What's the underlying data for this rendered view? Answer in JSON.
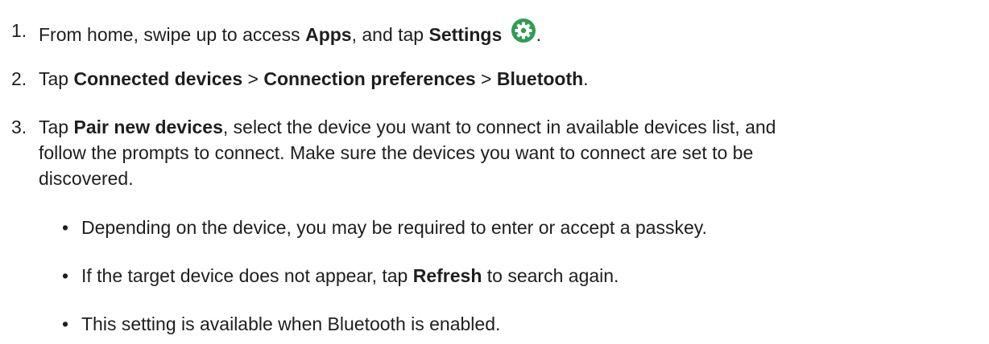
{
  "steps": [
    {
      "number": "1.",
      "t1": "From home, swipe up to access ",
      "b1": "Apps",
      "t2": ", and tap ",
      "b2": "Settings",
      "t3": "."
    },
    {
      "number": "2.",
      "t1": "Tap ",
      "b1": "Connected devices",
      "t2": " > ",
      "b2": "Connection preferences",
      "t3": " > ",
      "b3": "Bluetooth",
      "t4": "."
    },
    {
      "number": "3.",
      "t1": "Tap ",
      "b1": "Pair new devices",
      "t2": ", select the device you want to connect in available devices list, and",
      "line2": "follow the prompts to connect. Make sure the devices you want to connect are set to be",
      "line3": "discovered."
    }
  ],
  "bullets": [
    {
      "dot": "•",
      "t1": "Depending on the device, you may be required to enter or accept a passkey."
    },
    {
      "dot": "•",
      "t1": "If the target device does not appear, tap ",
      "b1": "Refresh",
      "t2": " to search again."
    },
    {
      "dot": "•",
      "t1": "This setting is available when Bluetooth is enabled."
    }
  ],
  "icons": {
    "settings": "gear-icon",
    "settings_color": "#2e9d55"
  }
}
